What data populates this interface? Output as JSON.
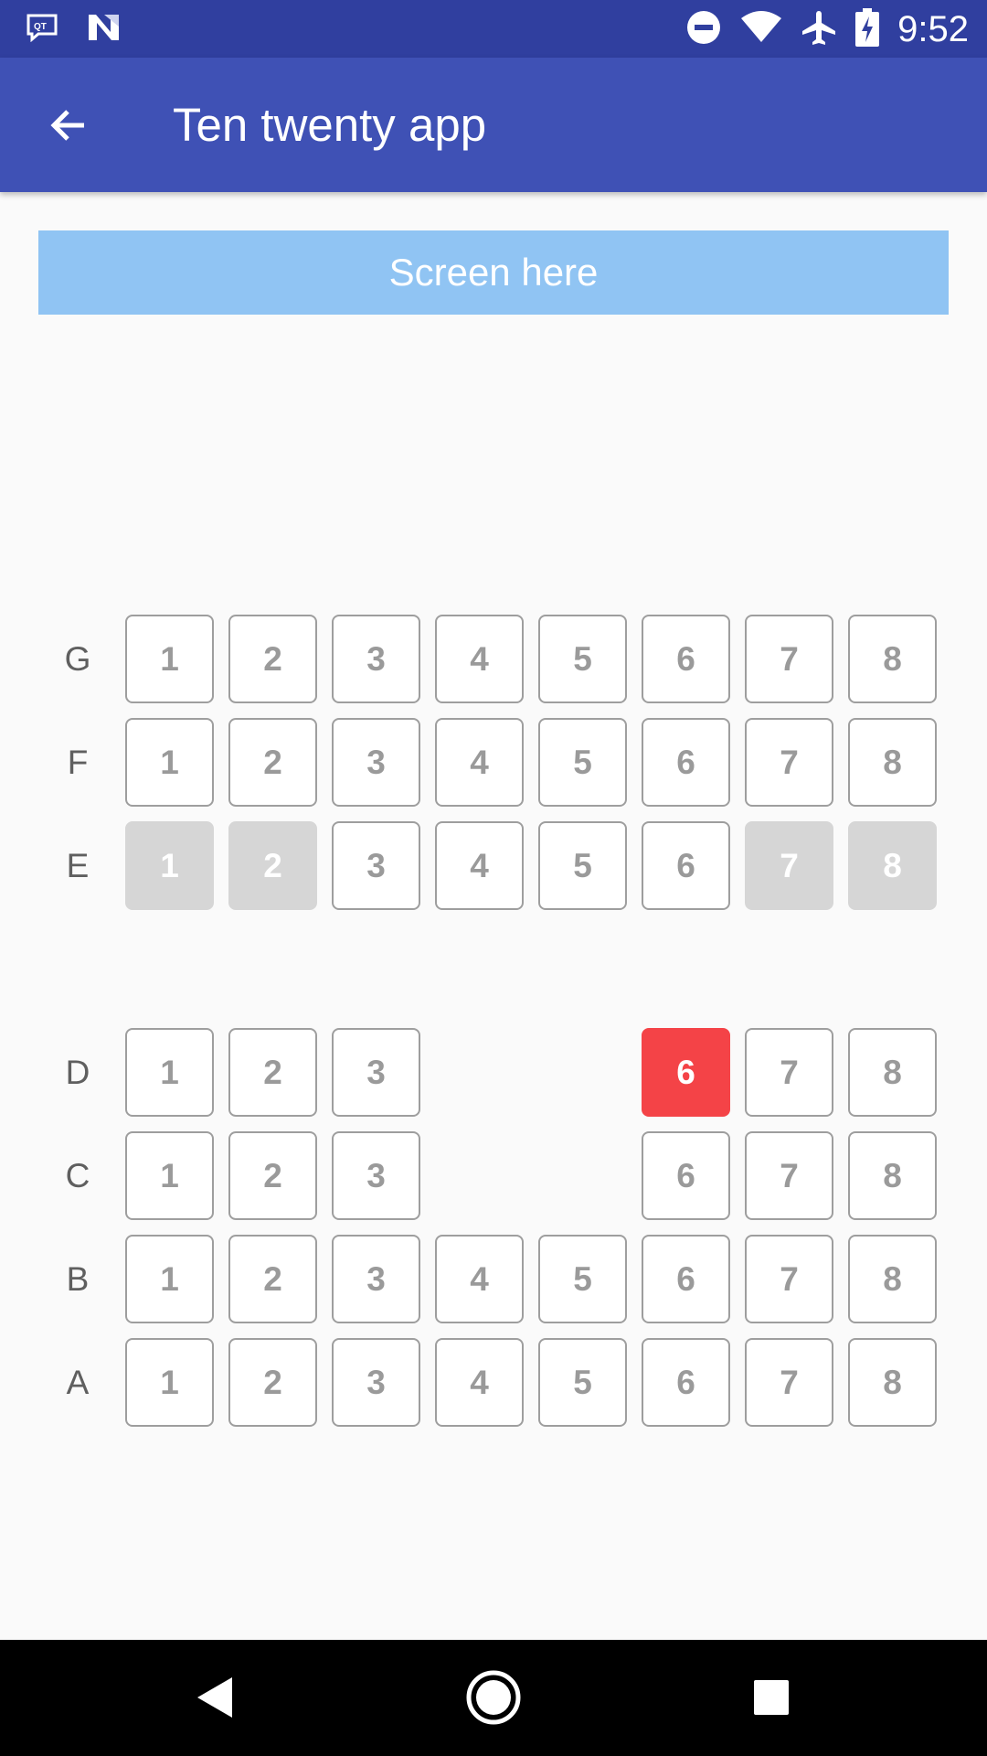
{
  "status_bar": {
    "time": "9:52",
    "left_icons": [
      "qt-notification-icon",
      "n-notification-icon"
    ],
    "right_icons": [
      "do-not-disturb-icon",
      "wifi-icon",
      "airplane-icon",
      "battery-charging-icon"
    ]
  },
  "app_bar": {
    "title": "Ten twenty app",
    "back_icon": "arrow-back-icon"
  },
  "screen_label": "Screen here",
  "colors": {
    "status_bar": "#303f9f",
    "app_bar": "#3f51b5",
    "screen_banner": "#90c4f3",
    "seat_border": "#9e9e9e",
    "seat_booked": "#d6d6d6",
    "seat_selected": "#f44347"
  },
  "seat_rows": [
    {
      "label": "G",
      "seats": [
        {
          "num": "1",
          "state": "available"
        },
        {
          "num": "2",
          "state": "available"
        },
        {
          "num": "3",
          "state": "available"
        },
        {
          "num": "4",
          "state": "available"
        },
        {
          "num": "5",
          "state": "available"
        },
        {
          "num": "6",
          "state": "available"
        },
        {
          "num": "7",
          "state": "available"
        },
        {
          "num": "8",
          "state": "available"
        }
      ]
    },
    {
      "label": "F",
      "seats": [
        {
          "num": "1",
          "state": "available"
        },
        {
          "num": "2",
          "state": "available"
        },
        {
          "num": "3",
          "state": "available"
        },
        {
          "num": "4",
          "state": "available"
        },
        {
          "num": "5",
          "state": "available"
        },
        {
          "num": "6",
          "state": "available"
        },
        {
          "num": "7",
          "state": "available"
        },
        {
          "num": "8",
          "state": "available"
        }
      ]
    },
    {
      "label": "E",
      "seats": [
        {
          "num": "1",
          "state": "booked"
        },
        {
          "num": "2",
          "state": "booked"
        },
        {
          "num": "3",
          "state": "available"
        },
        {
          "num": "4",
          "state": "available"
        },
        {
          "num": "5",
          "state": "available"
        },
        {
          "num": "6",
          "state": "available"
        },
        {
          "num": "7",
          "state": "booked"
        },
        {
          "num": "8",
          "state": "booked"
        }
      ]
    },
    {
      "label": "D",
      "seats": [
        {
          "num": "1",
          "state": "available"
        },
        {
          "num": "2",
          "state": "available"
        },
        {
          "num": "3",
          "state": "available"
        },
        null,
        null,
        {
          "num": "6",
          "state": "selected"
        },
        {
          "num": "7",
          "state": "available"
        },
        {
          "num": "8",
          "state": "available"
        }
      ]
    },
    {
      "label": "C",
      "seats": [
        {
          "num": "1",
          "state": "available"
        },
        {
          "num": "2",
          "state": "available"
        },
        {
          "num": "3",
          "state": "available"
        },
        null,
        null,
        {
          "num": "6",
          "state": "available"
        },
        {
          "num": "7",
          "state": "available"
        },
        {
          "num": "8",
          "state": "available"
        }
      ]
    },
    {
      "label": "B",
      "seats": [
        {
          "num": "1",
          "state": "available"
        },
        {
          "num": "2",
          "state": "available"
        },
        {
          "num": "3",
          "state": "available"
        },
        {
          "num": "4",
          "state": "available"
        },
        {
          "num": "5",
          "state": "available"
        },
        {
          "num": "6",
          "state": "available"
        },
        {
          "num": "7",
          "state": "available"
        },
        {
          "num": "8",
          "state": "available"
        }
      ]
    },
    {
      "label": "A",
      "seats": [
        {
          "num": "1",
          "state": "available"
        },
        {
          "num": "2",
          "state": "available"
        },
        {
          "num": "3",
          "state": "available"
        },
        {
          "num": "4",
          "state": "available"
        },
        {
          "num": "5",
          "state": "available"
        },
        {
          "num": "6",
          "state": "available"
        },
        {
          "num": "7",
          "state": "available"
        },
        {
          "num": "8",
          "state": "available"
        }
      ]
    }
  ],
  "nav_bar": {
    "icons": [
      "nav-back-icon",
      "nav-home-icon",
      "nav-recents-icon"
    ]
  }
}
